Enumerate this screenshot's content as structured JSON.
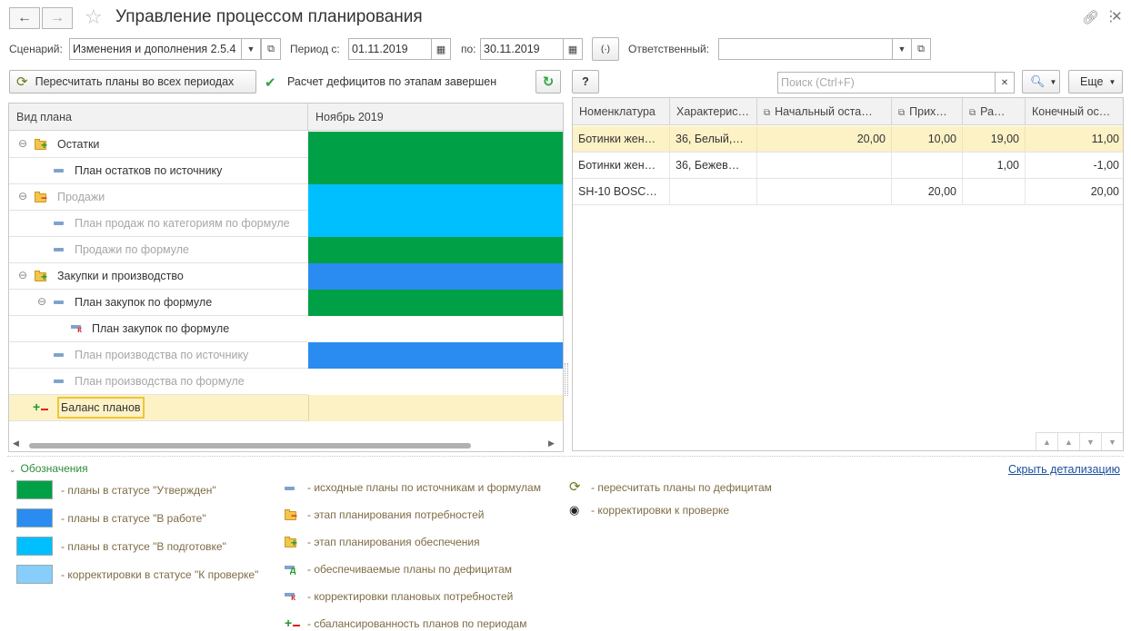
{
  "window": {
    "title": "Управление процессом планирования",
    "back_icon": "arrow-left-icon",
    "forward_icon": "arrow-right-icon",
    "favorite_icon": "star-icon",
    "link_icon": "link-icon",
    "more_icon": "more-icon",
    "close_icon": "close-icon"
  },
  "filters": {
    "scenario_label": "Сценарий:",
    "scenario_value": "Изменения и дополнения 2.5.4",
    "period_from_label": "Период с:",
    "period_from_value": "01.11.2019",
    "period_to_label": "по:",
    "period_to_value": "30.11.2019",
    "responsible_label": "Ответственный:",
    "responsible_value": ""
  },
  "toolbar": {
    "recalc_label": "Пересчитать планы во всех периодах",
    "status_text": "Расчет дефицитов по этапам завершен",
    "help_label": "?",
    "search_placeholder": "Поиск (Ctrl+F)",
    "more_label": "Еще"
  },
  "plans_grid": {
    "col_type": "Вид плана",
    "col_period": "Ноябрь 2019",
    "rows": [
      {
        "label": "Остатки",
        "dim": false,
        "color": "#00a046"
      },
      {
        "label": "План остатков по источнику",
        "dim": false,
        "color": "#00a046"
      },
      {
        "label": "Продажи",
        "dim": true,
        "color": "#00bfff"
      },
      {
        "label": "План продаж по категориям по формуле",
        "dim": true,
        "color": "#00bfff"
      },
      {
        "label": "Продажи по формуле",
        "dim": true,
        "color": "#00a046"
      },
      {
        "label": "Закупки и производство",
        "dim": false,
        "color": "#2a8cf0"
      },
      {
        "label": "План закупок по формуле",
        "dim": false,
        "color": "#00a046"
      },
      {
        "label": "План закупок по формуле",
        "dim": false,
        "color": "#ffffff"
      },
      {
        "label": "План производства по источнику",
        "dim": true,
        "color": "#2a8cf0"
      },
      {
        "label": "План производства по формуле",
        "dim": true,
        "color": "#ffffff"
      },
      {
        "label": "Баланс планов",
        "dim": false,
        "color": "#fdf1c6"
      }
    ]
  },
  "items_grid": {
    "columns": [
      "Номенклатура",
      "Характерис…",
      "Начальный оста…",
      "Прих…",
      "Ра…",
      "Конечный ос…"
    ],
    "rows": [
      [
        "Ботинки жен…",
        "36, Белый,…",
        "20,00",
        "10,00",
        "19,00",
        "11,00"
      ],
      [
        "Ботинки жен…",
        "36, Бежев…",
        "",
        "",
        "1,00",
        "-1,00"
      ],
      [
        "SH-10 BOSC…",
        "",
        "",
        "20,00",
        "",
        "20,00"
      ]
    ]
  },
  "legend": {
    "title": "Обозначения",
    "hide_link": "Скрыть детализацию",
    "col1": [
      {
        "color": "#00a046",
        "text": "- планы в статусе \"Утвержден\""
      },
      {
        "color": "#2a8cf0",
        "text": "- планы в статусе \"В работе\""
      },
      {
        "color": "#00bfff",
        "text": "- планы в статусе \"В подготовке\""
      },
      {
        "color": "#87cefa",
        "text": "- корректировки в статусе \"К проверке\""
      }
    ],
    "col2": [
      {
        "icon": "plan-minus-icon",
        "text": "- исходные планы по источникам и формулам"
      },
      {
        "icon": "folder-minus-icon",
        "text": "- этап планирования потребностей"
      },
      {
        "icon": "folder-plus-icon",
        "text": "- этап планирования обеспечения"
      },
      {
        "icon": "deficit-plan-icon",
        "text": "- обеспечиваемые планы по дефицитам"
      },
      {
        "icon": "correction-icon",
        "text": "- корректировки плановых потребностей"
      },
      {
        "icon": "balance-icon",
        "text": "- сбалансированность планов по периодам"
      }
    ],
    "col3": [
      {
        "icon": "recalc-icon",
        "text": "- пересчитать планы по дефицитам"
      },
      {
        "icon": "eye-icon",
        "text": "- корректировки к проверке"
      }
    ]
  }
}
